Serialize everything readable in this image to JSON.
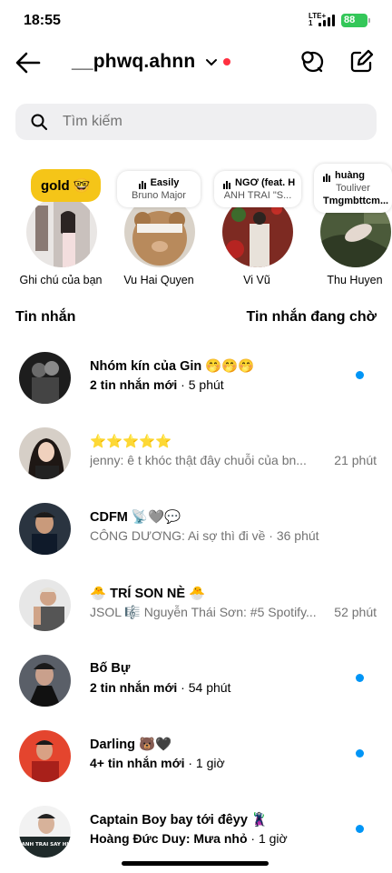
{
  "status": {
    "time": "18:55",
    "network": "LTE+",
    "network_sub": "1",
    "battery": "88"
  },
  "header": {
    "username": "__phwq.ahnn"
  },
  "search": {
    "placeholder": "Tìm kiếm"
  },
  "notes": [
    {
      "name": "Ghi chú của bạn",
      "note_text": "gold 🤓"
    },
    {
      "name": "Vu Hai Quyen",
      "song": "Easily",
      "artist": "Bruno Major"
    },
    {
      "name": "Vi Vũ",
      "song": "NGƠ (feat. H",
      "artist": "ANH TRAI \"S..."
    },
    {
      "name": "Thu Huyen",
      "song": "huàng",
      "artist": "Touliver",
      "extra": "Tmgmbttcm..."
    }
  ],
  "sections": {
    "messages": "Tin nhắn",
    "requests": "Tin nhắn đang chờ"
  },
  "messages": [
    {
      "title": "Nhóm kín của Gin 🤭🤭🤭",
      "preview": "2 tin nhắn mới",
      "time": " · 5 phút",
      "unread": true
    },
    {
      "title": "⭐⭐⭐⭐⭐",
      "preview": "jenny: ê t khóc thật đây chuỗi của bn...",
      "time": "21 phút",
      "unread": false
    },
    {
      "title": "CDFM 📡🩶💬",
      "preview": "CÔNG DƯƠNG: Ai sợ thì đi về",
      "time": " · 36 phút",
      "unread": false
    },
    {
      "title": "🐣 TRÍ SON NÈ 🐣",
      "preview": "JSOL 🎼 Nguyễn Thái Sơn: #5 Spotify...",
      "time": "52 phút",
      "unread": false
    },
    {
      "title": "Bố Bự",
      "preview": "2 tin nhắn mới",
      "time": " · 54 phút",
      "unread": true
    },
    {
      "title": "Darling 🐻🖤",
      "preview": "4+ tin nhắn mới",
      "time": " · 1 giờ",
      "unread": true
    },
    {
      "title": "Captain Boy bay tới đêyy 🦹",
      "preview": "Hoàng Đức Duy: Mưa nhỏ",
      "time": " · 1 giờ",
      "unread": true,
      "avatar_caption": "ANH TRAI SAY HI"
    }
  ],
  "colors": {
    "unread_dot": "#0095f6",
    "live_dot": "#ff3040",
    "gold_note": "#f5c518",
    "battery": "#34c759"
  }
}
